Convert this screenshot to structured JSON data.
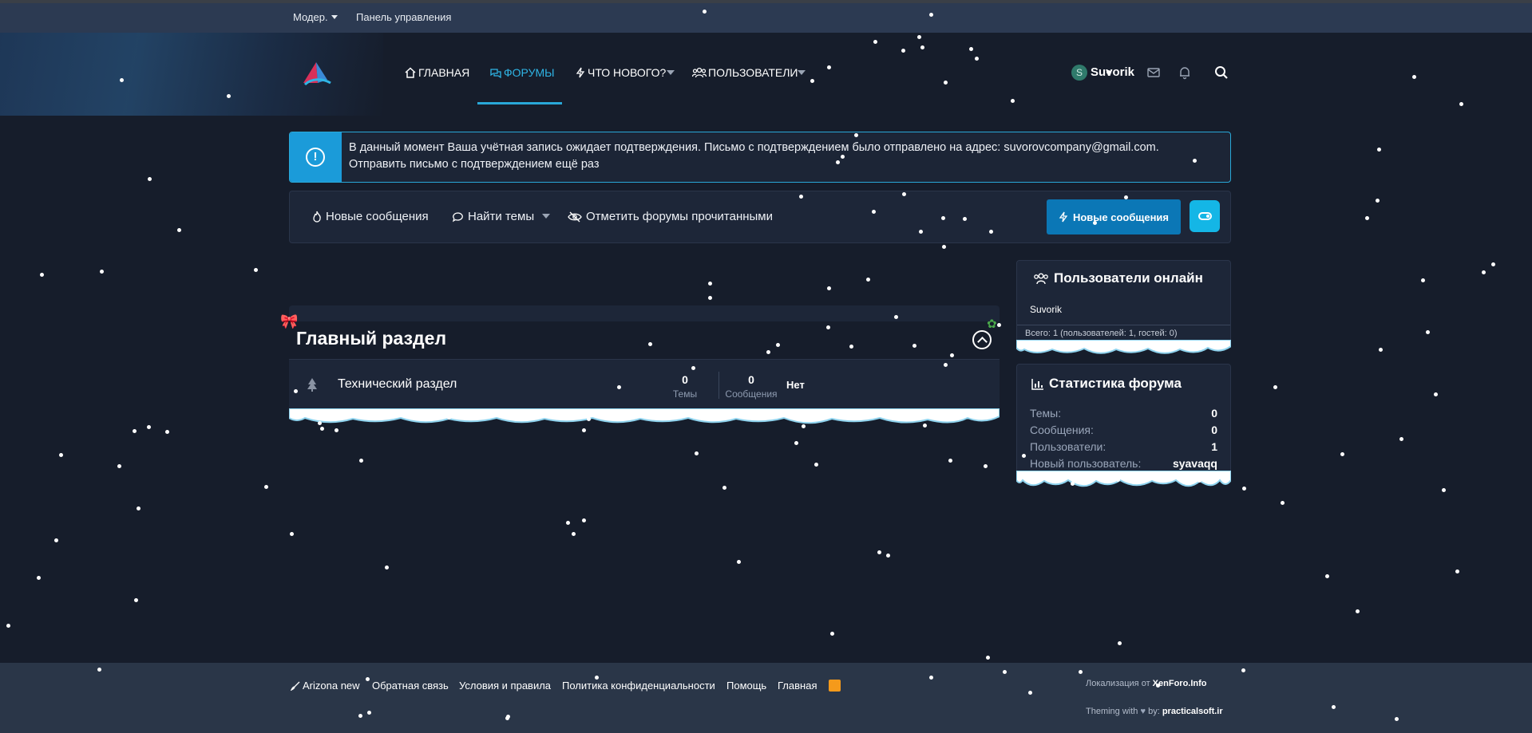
{
  "staffbar": {
    "moder_label": "Модер.",
    "admin_label": "Панель управления"
  },
  "nav": {
    "home": "ГЛАВНАЯ",
    "forums": "ФОРУМЫ",
    "whats_new": "ЧТО НОВОГО?",
    "members": "ПОЛЬЗОВАТЕЛИ",
    "avatar_letter": "S",
    "username": "Suvorik"
  },
  "notice": {
    "line1": "В данный момент Ваша учётная запись ожидает подтверждения. Письмо с подтверждением было отправлено на адрес: suvorovcompany@gmail.com.",
    "line2": "Отправить письмо с подтверждением ещё раз"
  },
  "actions": {
    "new_posts": "Новые сообщения",
    "find_threads": "Найти темы",
    "mark_read": "Отметить форумы прочитанными",
    "new_posts_button": "Новые сообщения"
  },
  "forum": {
    "category_title": "Главный раздел",
    "nodes": [
      {
        "name": "Технический раздел",
        "threads": "0",
        "threads_label": "Темы",
        "messages": "0",
        "messages_label": "Сообщения",
        "last_post": "Нет"
      }
    ]
  },
  "online_widget": {
    "title": "Пользователи онлайн",
    "user": "Suvorik",
    "total": "Всего: 1 (пользователей: 1, гостей: 0)"
  },
  "stats_widget": {
    "title": "Статистика форума",
    "rows": [
      {
        "label": "Темы:",
        "value": "0"
      },
      {
        "label": "Сообщения:",
        "value": "0"
      },
      {
        "label": "Пользователи:",
        "value": "1"
      },
      {
        "label": "Новый пользователь:",
        "value": "syavaqq"
      }
    ]
  },
  "footer": {
    "links": [
      "Arizona new",
      "Обратная связь",
      "Условия и правила",
      "Политика конфиденциальности",
      "Помощь",
      "Главная"
    ],
    "localization_prefix": "Локализация от",
    "localization_brand": "XenForo.Info",
    "theming_prefix": "Theming with",
    "theming_by": "by:",
    "theming_brand": "practicalsoft.ir"
  },
  "colors": {
    "accent": "#29a8d8",
    "button": "#0b77b6",
    "background": "#161d2b",
    "panel": "#1d2638"
  }
}
